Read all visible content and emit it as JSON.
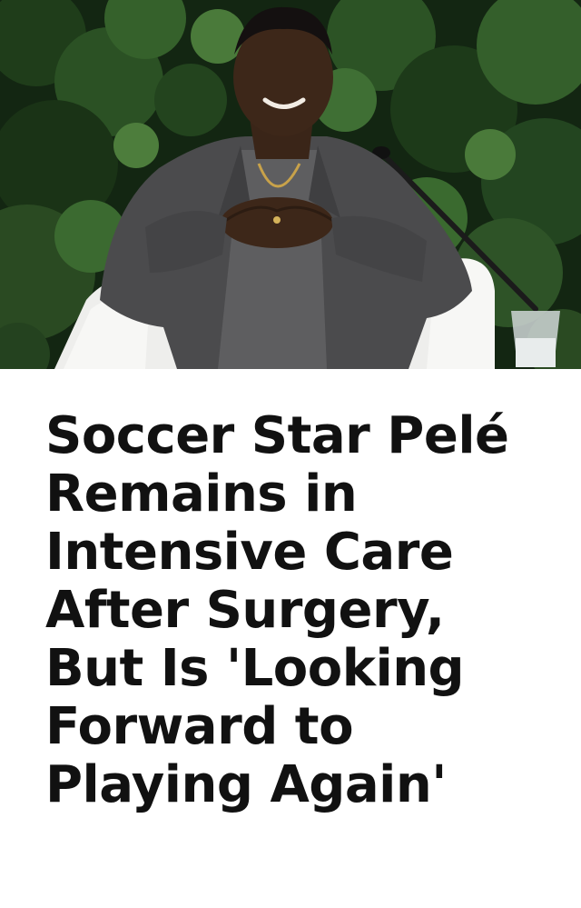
{
  "article": {
    "headline": "Soccer Star Pelé\nRemains in\nIntensive Care\nAfter Surgery,\nBut Is 'Looking\nForward to\nPlaying Again'"
  },
  "colors": {
    "background": "#ffffff",
    "headline_text": "#111111",
    "foliage_dark": "#0f1f10",
    "suit": "#4b4b4d",
    "sweater": "#5e5e60",
    "chair": "#f3f3f1"
  }
}
